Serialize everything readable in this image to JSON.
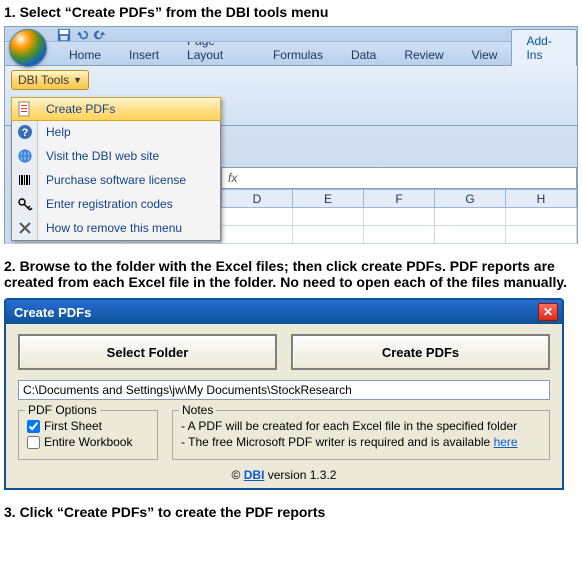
{
  "steps": {
    "s1": "1.  Select “Create PDFs” from the DBI tools menu",
    "s2": "2.  Browse to the folder with the Excel files; then click create PDFs.  PDF reports are created from each Excel file in the folder.  No need to open each of the files manually.",
    "s3": "3. Click “Create PDFs” to create the PDF reports"
  },
  "ribbon": {
    "tabs": {
      "home": "Home",
      "insert": "Insert",
      "page_layout": "Page Layout",
      "formulas": "Formulas",
      "data": "Data",
      "review": "Review",
      "view": "View",
      "addins": "Add-Ins"
    },
    "dbi_tools_label": "DBI Tools",
    "fx_label": "fx",
    "columns": {
      "d": "D",
      "e": "E",
      "f": "F",
      "g": "G",
      "h": "H"
    }
  },
  "dbi_menu": {
    "create_pdfs": "Create PDFs",
    "help": "Help",
    "visit": "Visit the DBI web site",
    "purchase": "Purchase software license",
    "enter_codes": "Enter registration codes",
    "remove": "How to remove this menu"
  },
  "dialog": {
    "title": "Create PDFs",
    "select_folder": "Select Folder",
    "create_pdfs": "Create PDFs",
    "path_value": "C:\\Documents and Settings\\jw\\My Documents\\StockResearch",
    "pdf_options_legend": "PDF Options",
    "first_sheet": "First Sheet",
    "entire_workbook": "Entire Workbook",
    "notes_legend": "Notes",
    "note1": "- A PDF will be created for each Excel file in the specified folder",
    "note2_prefix": "- The free Microsoft PDF writer is required and is available ",
    "note2_link": "here",
    "footer_copy": "© ",
    "footer_dbi": "DBI",
    "footer_version": "  version 1.3.2"
  }
}
